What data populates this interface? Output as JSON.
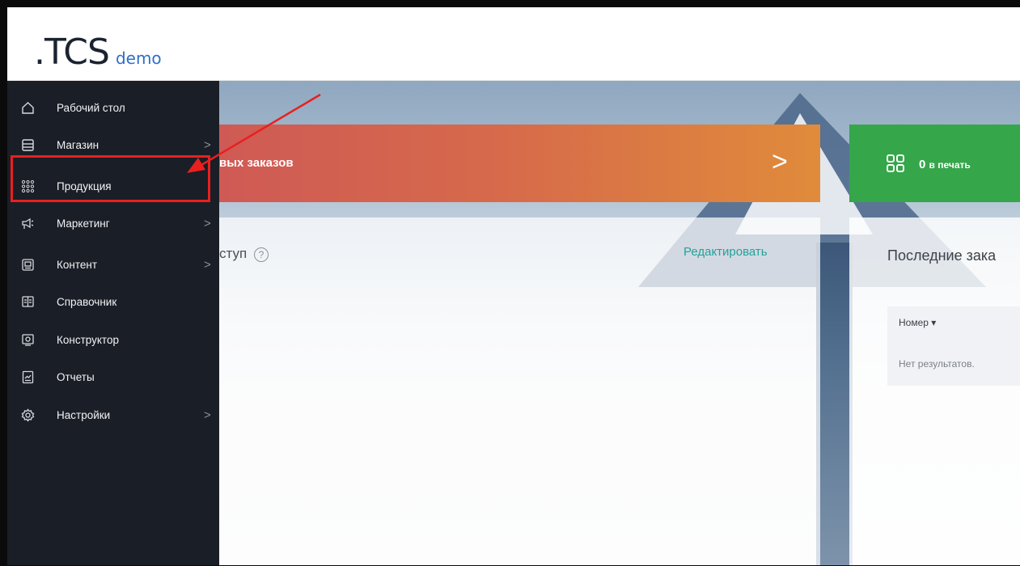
{
  "header": {
    "logo_main": ".TCS",
    "logo_suffix": "demo"
  },
  "sidebar": {
    "items": [
      {
        "label": "Рабочий стол",
        "icon": "home-icon",
        "has_submenu": false
      },
      {
        "label": "Магазин",
        "icon": "store-icon",
        "has_submenu": true
      },
      {
        "label": "Продукция",
        "icon": "grid-dots-icon",
        "has_submenu": false,
        "highlighted": true
      },
      {
        "label": "Маркетинг",
        "icon": "megaphone-icon",
        "has_submenu": true
      },
      {
        "label": "Контент",
        "icon": "content-icon",
        "has_submenu": true
      },
      {
        "label": "Справочник",
        "icon": "book-icon",
        "has_submenu": false
      },
      {
        "label": "Конструктор",
        "icon": "constructor-icon",
        "has_submenu": false
      },
      {
        "label": "Отчеты",
        "icon": "report-icon",
        "has_submenu": false
      },
      {
        "label": "Настройки",
        "icon": "gear-icon",
        "has_submenu": true
      }
    ],
    "chevron": ">"
  },
  "main": {
    "orange_banner": {
      "text": "вых заказов",
      "chevron": ">"
    },
    "green_banner": {
      "count": "0",
      "label": "в печать"
    },
    "quick_access": {
      "title": "ступ",
      "help": "?",
      "edit_label": "Редактировать"
    },
    "recent_orders": {
      "title": "Последние зака",
      "column": "Номер ▾",
      "empty_text": "Нет результатов."
    }
  },
  "colors": {
    "sidebar_bg": "#1a1e26",
    "accent_red": "#e8201e",
    "orange_start": "#cf5a55",
    "orange_end": "#e08b3b",
    "green": "#35a64a",
    "link_teal": "#22a39a",
    "logo_blue": "#2f6fc8"
  }
}
